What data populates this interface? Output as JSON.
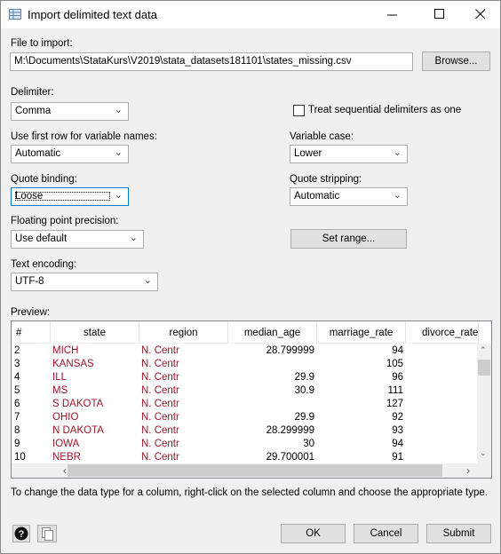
{
  "window": {
    "title": "Import delimited text data",
    "icon": "table-window-icon"
  },
  "file": {
    "label": "File to import:",
    "value": "M:\\Documents\\StataKurs\\V2019\\stata_datasets181101\\states_missing.csv",
    "browse": "Browse..."
  },
  "delimiter": {
    "label": "Delimiter:",
    "value": "Comma"
  },
  "sequential": {
    "label": "Treat sequential delimiters as one",
    "checked": false
  },
  "first_row": {
    "label": "Use first row for variable names:",
    "value": "Automatic"
  },
  "var_case": {
    "label": "Variable case:",
    "value": "Lower"
  },
  "quote_binding": {
    "label": "Quote binding:",
    "value": "Loose"
  },
  "quote_stripping": {
    "label": "Quote stripping:",
    "value": "Automatic"
  },
  "float_prec": {
    "label": "Floating point precision:",
    "value": "Use default"
  },
  "set_range": "Set range...",
  "encoding": {
    "label": "Text encoding:",
    "value": "UTF-8"
  },
  "preview": {
    "label": "Preview:",
    "columns": [
      "#",
      "state",
      "region",
      "median_age",
      "marriage_rate",
      "divorce_rate"
    ],
    "rows": [
      [
        "2",
        "MICH",
        "N. Centr",
        "28.799999",
        "94",
        ""
      ],
      [
        "3",
        "KANSAS",
        "N. Centr",
        "",
        "105",
        ""
      ],
      [
        "4",
        "ILL",
        "N. Centr",
        "29.9",
        "96",
        ""
      ],
      [
        "5",
        "MS",
        "N. Centr",
        "30.9",
        "111",
        ""
      ],
      [
        "6",
        "S DAKOTA",
        "N. Centr",
        "",
        "127",
        ""
      ],
      [
        "7",
        "OHIO",
        "N. Centr",
        "29.9",
        "92",
        ""
      ],
      [
        "8",
        "N DAKOTA",
        "N. Centr",
        "28.299999",
        "93",
        ""
      ],
      [
        "9",
        "IOWA",
        "N. Centr",
        "30",
        "94",
        ""
      ],
      [
        "10",
        "NEBR",
        "N. Centr",
        "29.700001",
        "91",
        ""
      ]
    ],
    "string_color": "#a0142a"
  },
  "hint": "To change the data type for a column, right-click on the selected column and choose the appropriate type.",
  "buttons": {
    "ok": "OK",
    "cancel": "Cancel",
    "submit": "Submit"
  }
}
